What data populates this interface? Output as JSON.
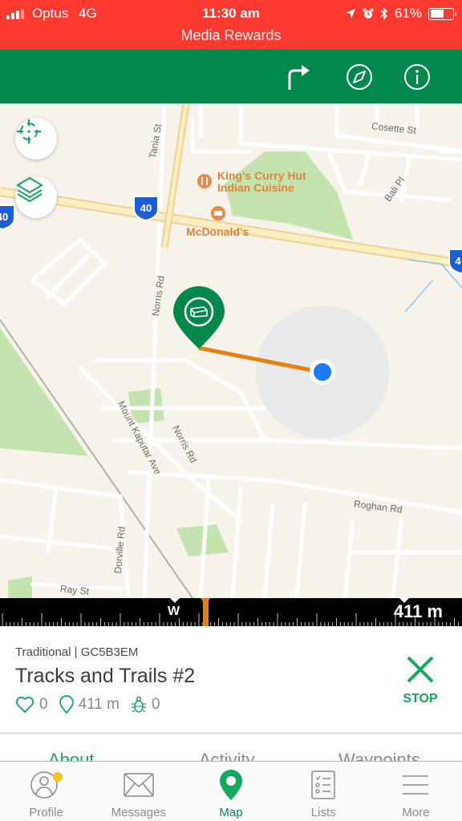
{
  "status_bar": {
    "carrier": "Optus",
    "network": "4G",
    "time": "11:30 am",
    "battery_percent": "61%",
    "battery_level": 0.61,
    "signal_bars": 3,
    "icons": [
      "location-arrow-icon",
      "alarm-icon",
      "bluetooth-icon"
    ],
    "banner": "Media Rewards",
    "color": "#fe3a30"
  },
  "nav_bar": {
    "color": "#02874d",
    "actions": [
      {
        "name": "directions-icon",
        "label": "Directions"
      },
      {
        "name": "compass-icon",
        "label": "Compass"
      },
      {
        "name": "info-icon",
        "label": "Info"
      }
    ]
  },
  "map": {
    "controls": [
      {
        "name": "my-location-icon",
        "label": "Locate"
      },
      {
        "name": "layers-icon",
        "label": "Map layers"
      }
    ],
    "street_labels": [
      "Tania St",
      "Cosette St",
      "Bali Pl",
      "Norris Rd",
      "Norris Rd",
      "Mount Kaputar Ave",
      "Roghan Rd",
      "Dorville Rd",
      "Ray St"
    ],
    "highway_shields": [
      "40",
      "40",
      "40",
      "4"
    ],
    "pois": [
      {
        "name": "King's Curry Hut Indian Cuisine",
        "line1": "King's Curry Hut",
        "line2": "Indian Cuisine",
        "icon": "restaurant-icon"
      },
      {
        "name": "McDonald's",
        "icon": "fast-food-icon"
      }
    ],
    "cache_marker": "traditional-cache-icon",
    "route_color": "#e8800f",
    "user_location_color": "#1a7cf5"
  },
  "compass": {
    "heading_label": "W",
    "distance": "411 m",
    "marker_color": "#e8800f"
  },
  "cache": {
    "type_line": "Traditional | GC5B3EM",
    "type": "Traditional",
    "code": "GC5B3EM",
    "name": "Tracks and Trails #2",
    "favorites": "0",
    "distance": "411 m",
    "trackables": "0",
    "stop_label": "STOP",
    "accent": "#14a85c"
  },
  "detail_tabs": [
    {
      "label": "About",
      "active": true
    },
    {
      "label": "Activity",
      "active": false
    },
    {
      "label": "Waypoints",
      "active": false
    }
  ],
  "tab_bar": {
    "items": [
      {
        "label": "Profile",
        "icon": "profile-icon",
        "badge": true,
        "active": false
      },
      {
        "label": "Messages",
        "icon": "messages-icon",
        "active": false
      },
      {
        "label": "Map",
        "icon": "map-pin-icon",
        "active": true
      },
      {
        "label": "Lists",
        "icon": "lists-icon",
        "active": false
      },
      {
        "label": "More",
        "icon": "menu-icon",
        "active": false
      }
    ],
    "badge_color": "#f7c51a"
  }
}
